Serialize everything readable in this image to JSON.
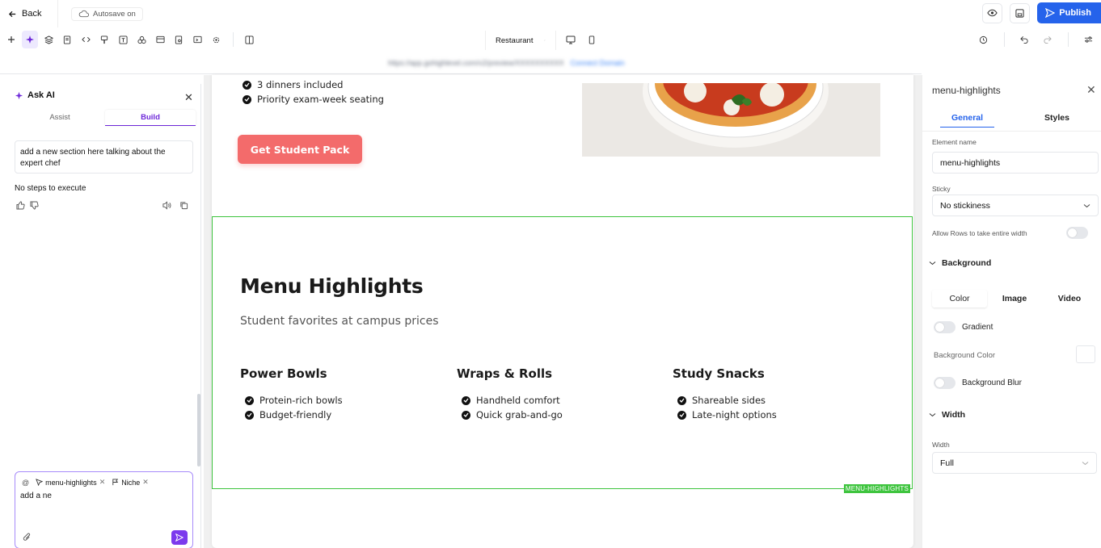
{
  "topbar": {
    "back_label": "Back",
    "autosave_label": "Autosave on",
    "publish_label": "Publish"
  },
  "toolbar": {
    "page_name": "Restaurant",
    "icons": [
      "add-icon",
      "ai-sparkle-icon",
      "layers-icon",
      "pages-icon",
      "code-icon",
      "brush-icon",
      "text-icon",
      "components-icon",
      "layout-icon",
      "form-icon",
      "media-icon",
      "settings-icon",
      "split-view-icon"
    ]
  },
  "urlbar": {
    "url": "https://app.gohighlevel.com/v2/preview/XXXXXXXXXX",
    "link": "Connect Domain"
  },
  "canvas": {
    "partial_items": [
      "3 dinners included",
      "Priority exam-week seating"
    ],
    "cta_label": "Get Student Pack",
    "section_tag": "MENU-HIGHLIGHTS",
    "section_title": "Menu Highlights",
    "section_subtitle": "Student favorites at campus prices",
    "columns": [
      {
        "title": "Power Bowls",
        "items": [
          "Protein-rich bowls",
          "Budget-friendly"
        ]
      },
      {
        "title": "Wraps & Rolls",
        "items": [
          "Handheld comfort",
          "Quick grab-and-go"
        ]
      },
      {
        "title": "Study Snacks",
        "items": [
          "Shareable sides",
          "Late-night options"
        ]
      }
    ]
  },
  "ai_panel": {
    "title": "Ask AI",
    "tabs": [
      "Assist",
      "Build"
    ],
    "active_tab": "Build",
    "message": "add a new section here talking about the expert chef",
    "steps_text": "No steps to execute",
    "chips": [
      "menu-highlights",
      "Niche"
    ],
    "input_value": "add a ne"
  },
  "props": {
    "title": "menu-highlights",
    "tabs": [
      "General",
      "Styles"
    ],
    "active_tab": "General",
    "element_name_label": "Element name",
    "element_name_value": "menu-highlights",
    "sticky_label": "Sticky",
    "sticky_value": "No stickiness",
    "allow_rows_label": "Allow Rows to take entire width",
    "background_label": "Background",
    "bg_tabs": [
      "Color",
      "Image",
      "Video"
    ],
    "gradient_label": "Gradient",
    "bg_color_label": "Background Color",
    "bg_blur_label": "Background Blur",
    "width_section_label": "Width",
    "width_label": "Width",
    "width_value": "Full"
  },
  "colors": {
    "accent": "#2563eb",
    "ai_accent": "#7c3aed",
    "cta": "#f36b6b",
    "section_outline": "#3ec43e"
  }
}
